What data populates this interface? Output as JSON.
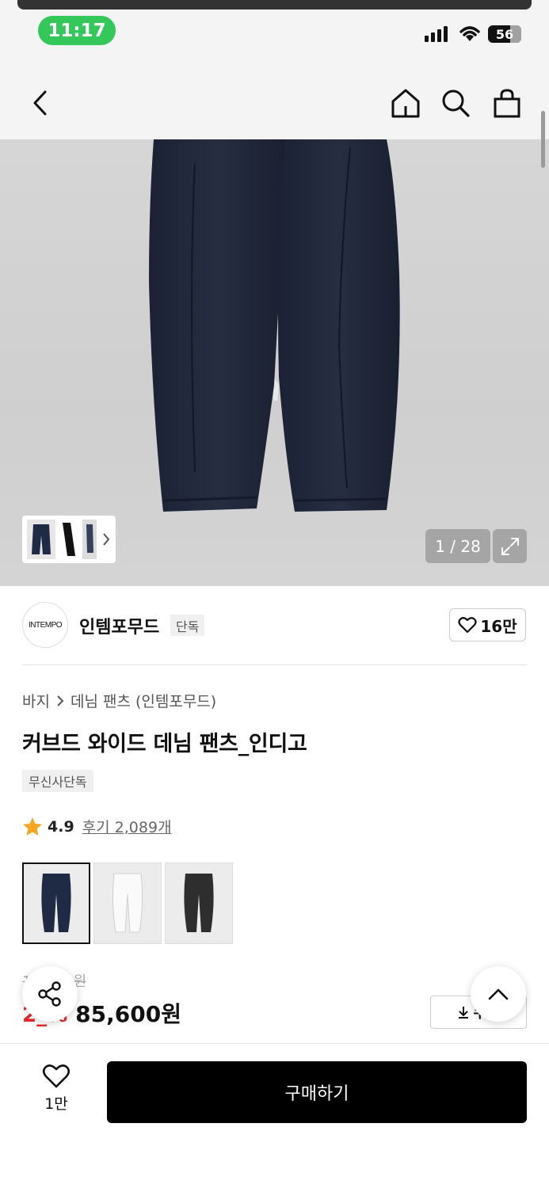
{
  "status": {
    "time": "11:17",
    "battery": "56"
  },
  "header": {
    "back_icon": "chevron-left-icon",
    "home_icon": "home-icon",
    "search_icon": "search-icon",
    "bag_icon": "shopping-bag-icon"
  },
  "gallery": {
    "pager": "1 / 28",
    "expand_icon": "expand-icon",
    "thumbs_next_icon": "chevron-right-icon"
  },
  "brand": {
    "logo_text": "INTEMPO",
    "name": "인템포무드",
    "tag": "단독",
    "likes": "16만"
  },
  "breadcrumb": {
    "category": "바지",
    "subcategory": "데님 팬츠 (인템포무드)"
  },
  "product": {
    "title": "커브드 와이드 데님 팬츠_인디고",
    "exclusive_tag": "무신사단독",
    "rating": "4.9",
    "reviews": "후기 2,089개",
    "original_price": "1__,__0원",
    "discount": "2_%",
    "price": "85,600원",
    "coupon_label": "쿠폰"
  },
  "swatches": [
    {
      "color": "#1f2a44",
      "name": "indigo"
    },
    {
      "color": "#eeeeee",
      "name": "white"
    },
    {
      "color": "#2e2e2e",
      "name": "charcoal"
    }
  ],
  "bottom": {
    "wish_count": "1만",
    "buy_label": "구매하기"
  },
  "colors": {
    "accent_green": "#34c759",
    "discount_red": "#e52a2a",
    "star": "#f5a623"
  }
}
